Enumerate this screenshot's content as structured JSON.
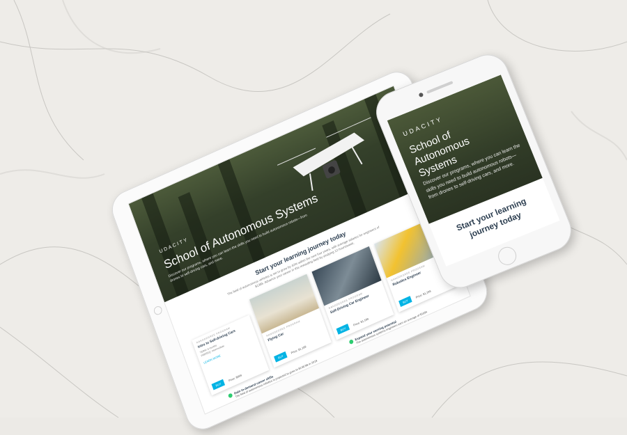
{
  "tablet": {
    "logo": "UDACITY",
    "title": "School of Autonomous Systems",
    "subtitle": "Discover our programs, where you can learn the skills you need to build autonomous robots—from drones to self-driving cars, and more.",
    "section_title": "Start your learning journey today",
    "section_sub": "The field of autonomous vehicles is set to grow by 42% within the next four years, with average salaries for engineers of $138k. Advance your career in this rewarding field by studying 12 hours/week.",
    "cards": [
      {
        "kicker": "NANODEGREE PROGRAM",
        "name": "Intro to Self-driving Cars",
        "meta1": "TERM: 6 months",
        "meta2": "PREREQ: Intermediate",
        "link": "LEARN MORE",
        "buy": "BUY",
        "price": "Price: $999"
      },
      {
        "kicker": "NANODEGREE PROGRAM",
        "name": "Flying Car",
        "buy": "BUY",
        "price": "Price: $1,199"
      },
      {
        "kicker": "NANODEGREE PROGRAM",
        "name": "Self-Driving Car Engineer",
        "buy": "BUY",
        "price": "Price: $1,199"
      },
      {
        "kicker": "NANODEGREE PROGRAM",
        "name": "Robotics Engineer",
        "buy": "BUY",
        "price": "Price: $1,199"
      }
    ],
    "benefits": [
      {
        "title": "Gain in-demand career skills",
        "text": "The field of autonomous robotics is projected to grow to $148.9B in 2019"
      },
      {
        "title": "Expand your earning potential",
        "text": "The autonomous systems engineers earn an average of $160k"
      }
    ]
  },
  "phone": {
    "logo": "UDACITY",
    "title": "School of Autonomous Systems",
    "subtitle": "Discover our programs, where you can learn the skills you need to build autonomous robots—from drones to self-driving cars, and more.",
    "section_title": "Start your learning journey today"
  },
  "colors": {
    "accent": "#02b3e4",
    "heading": "#2c3e50",
    "forest": "#3a4630"
  }
}
